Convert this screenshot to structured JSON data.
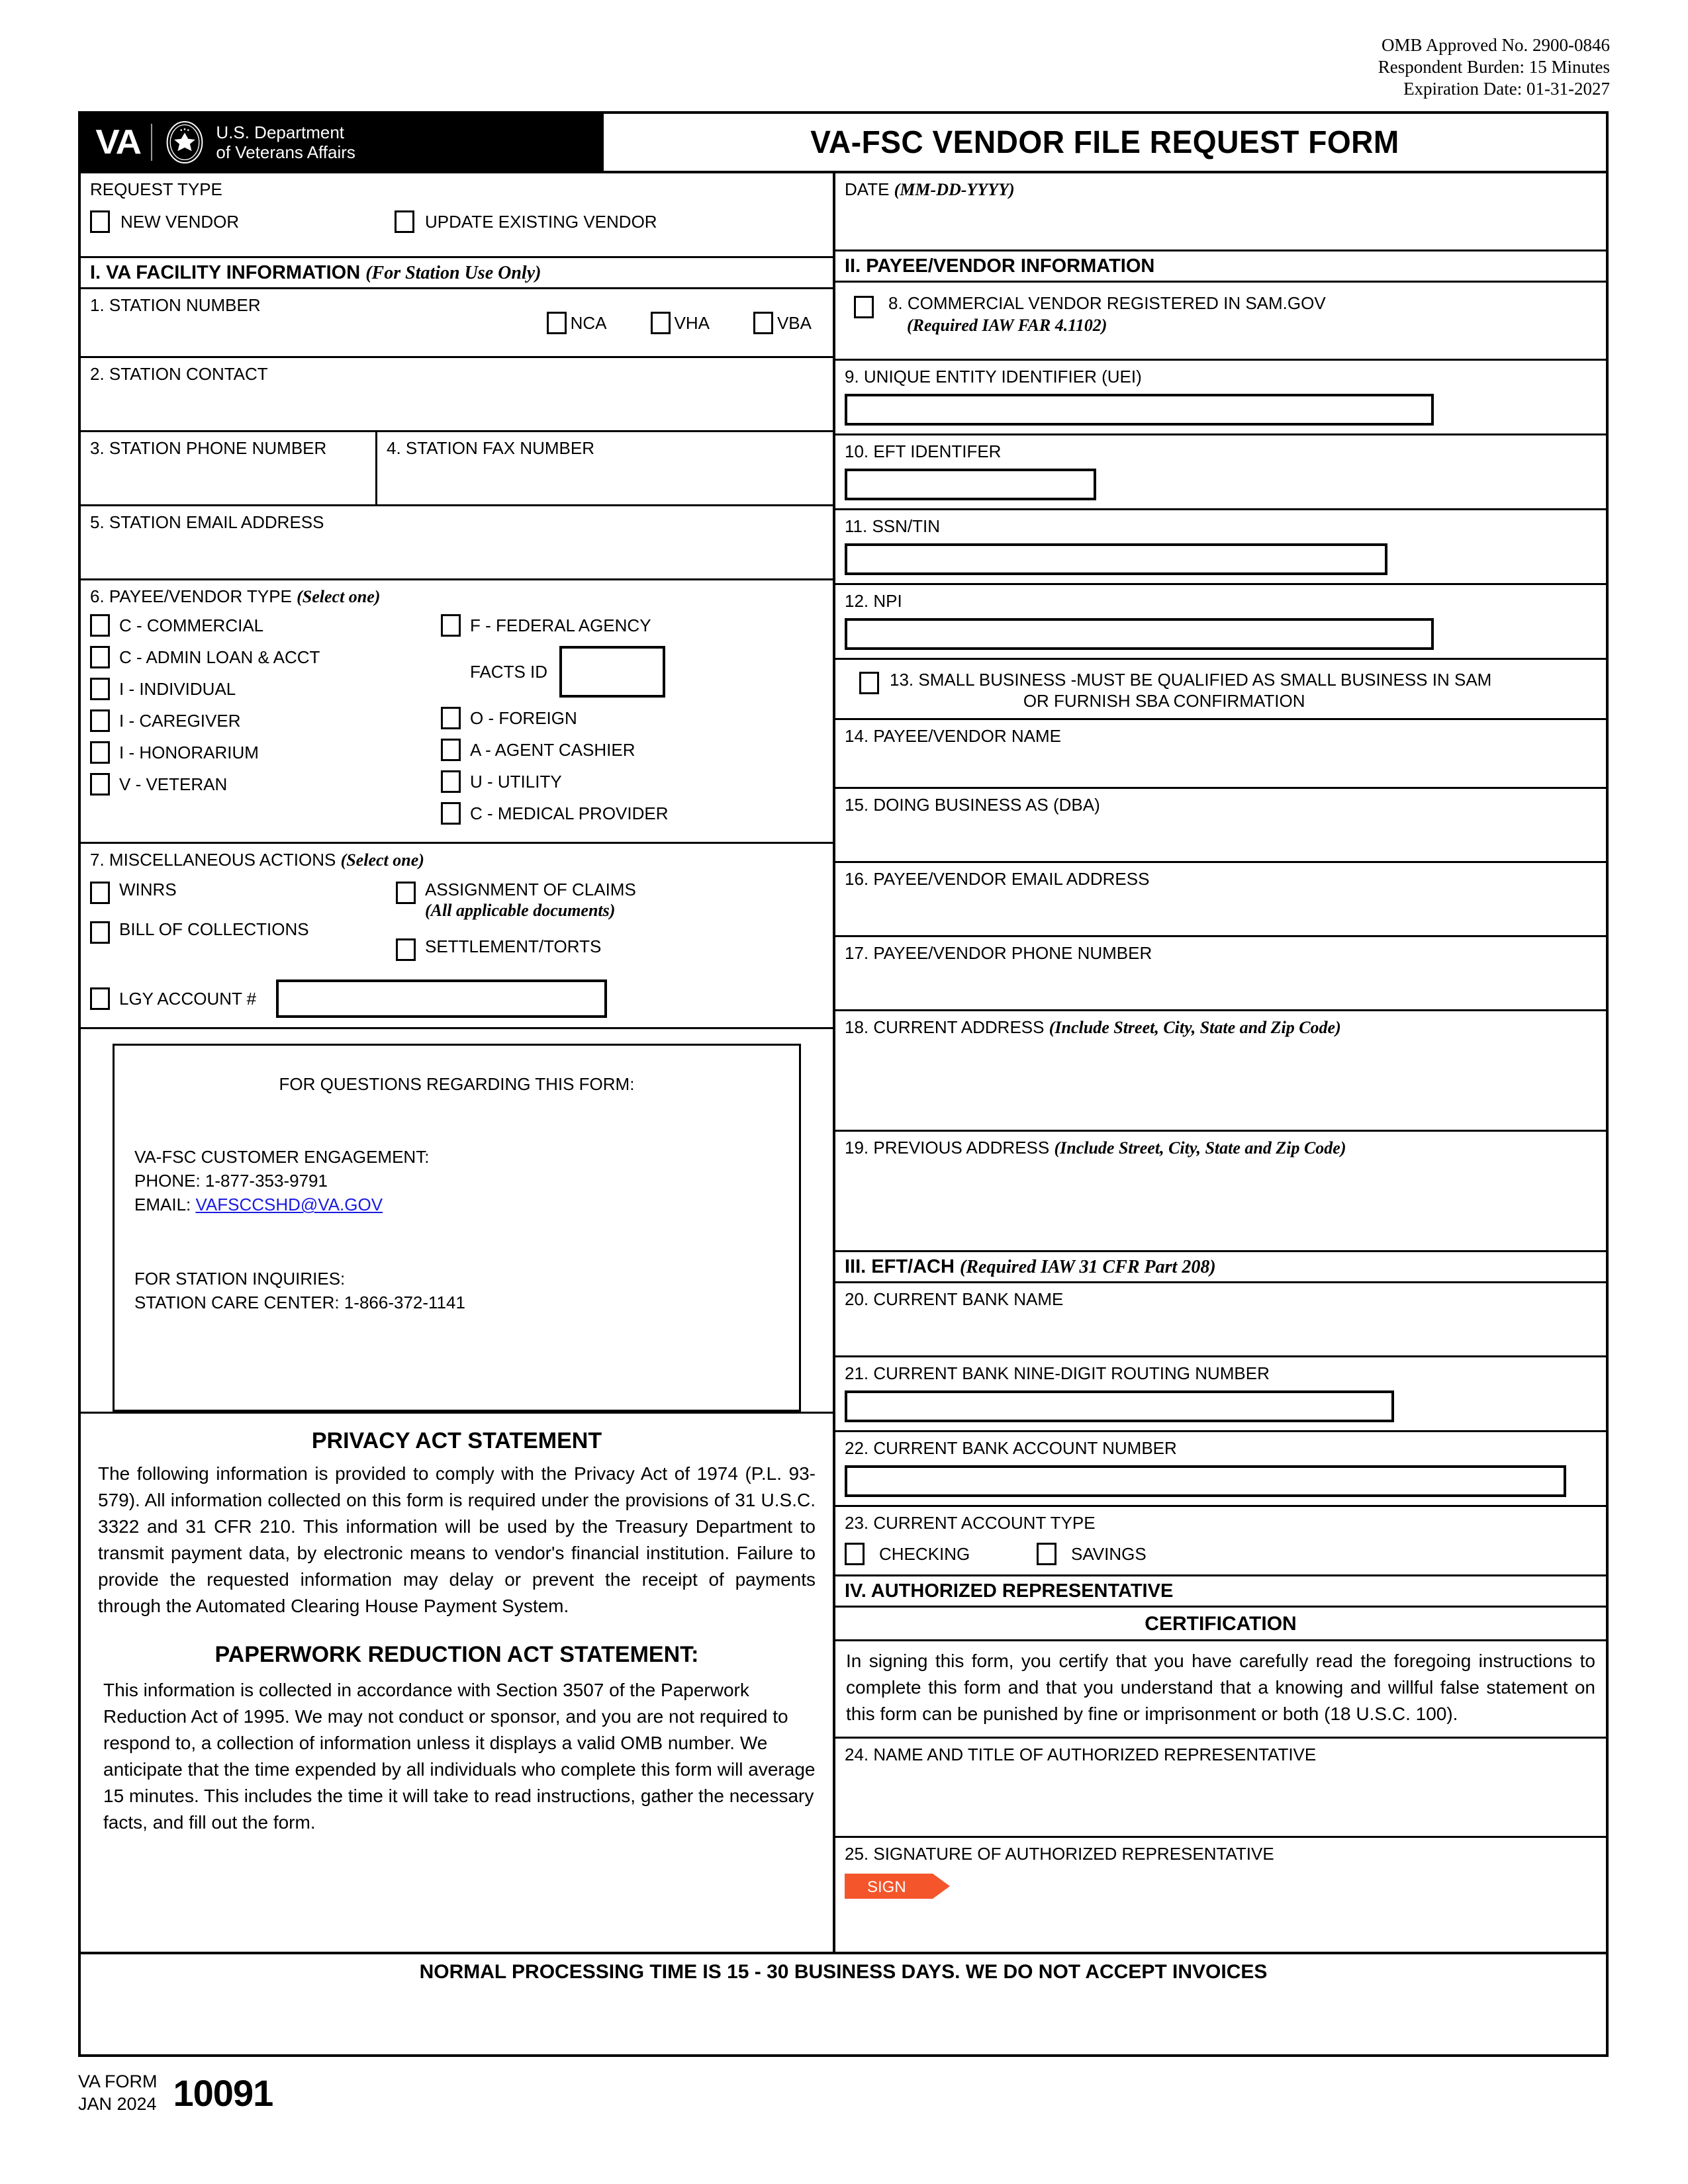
{
  "omb": {
    "approved": "OMB Approved No. 2900-0846",
    "burden": "Respondent Burden: 15 Minutes",
    "expiration": "Expiration Date: 01-31-2027"
  },
  "header": {
    "va_abbrev": "VA",
    "department_line1": "U.S. Department",
    "department_line2": "of Veterans Affairs",
    "form_title": "VA-FSC VENDOR FILE REQUEST FORM"
  },
  "request_type": {
    "label": "REQUEST TYPE",
    "options": [
      {
        "label": "NEW VENDOR"
      },
      {
        "label": "UPDATE EXISTING VENDOR"
      }
    ]
  },
  "date_field": {
    "label": "DATE",
    "format": "(MM-DD-YYYY)"
  },
  "section_1": {
    "title": "I.  VA FACILITY INFORMATION",
    "note": "(For Station Use Only)"
  },
  "section_2": {
    "title": "II.  PAYEE/VENDOR INFORMATION"
  },
  "section_3": {
    "title": "III.  EFT/ACH",
    "note": "(Required IAW 31 CFR Part 208)"
  },
  "section_4": {
    "title": "IV.  AUTHORIZED REPRESENTATIVE"
  },
  "facility": {
    "station_number": "1. STATION NUMBER",
    "agencies": [
      "NCA",
      "VHA",
      "VBA"
    ],
    "station_contact": "2. STATION CONTACT",
    "station_phone": "3. STATION PHONE NUMBER",
    "station_fax": "4. STATION FAX NUMBER",
    "station_email": "5. STATION EMAIL ADDRESS"
  },
  "vendor_type": {
    "label": "6. PAYEE/VENDOR TYPE",
    "note": "(Select one)",
    "col1": [
      "C - COMMERCIAL",
      "C - ADMIN LOAN & ACCT",
      "I - INDIVIDUAL",
      "I - CAREGIVER",
      "I - HONORARIUM",
      "V - VETERAN"
    ],
    "col2": [
      "F - FEDERAL AGENCY",
      "O - FOREIGN",
      "A - AGENT CASHIER",
      "U - UTILITY",
      "C - MEDICAL PROVIDER"
    ],
    "facts_id_label": "FACTS ID"
  },
  "misc_actions": {
    "label": "7. MISCELLANEOUS ACTIONS",
    "note": "(Select one)",
    "col1": [
      "WINRS",
      "BILL OF COLLECTIONS"
    ],
    "col2_1_line1": "ASSIGNMENT OF CLAIMS",
    "col2_1_line2": "(All applicable documents)",
    "col2_2": "SETTLEMENT/TORTS",
    "lgy_label": "LGY ACCOUNT #"
  },
  "questions_box": {
    "heading": "FOR QUESTIONS REGARDING THIS FORM:",
    "ce_title": "VA-FSC CUSTOMER ENGAGEMENT:",
    "phone_label": "PHONE:",
    "phone_value": "1-877-353-9791",
    "email_label": "EMAIL:",
    "email_value": "VAFSCCSHD@VA.GOV",
    "station_title": "FOR STATION INQUIRIES:",
    "station_line": "STATION CARE CENTER:  1-866-372-1141"
  },
  "privacy_act": {
    "title": "PRIVACY ACT STATEMENT",
    "body": "The following information is provided to comply with the Privacy Act of 1974 (P.L. 93-579). All information collected on this form is required under the provisions of 31 U.S.C. 3322 and 31 CFR 210. This information will be used by the Treasury Department to transmit payment data, by electronic means to vendor's financial institution. Failure to provide the requested information may delay or prevent the receipt of payments through the Automated Clearing House Payment System."
  },
  "paperwork_act": {
    "title": "PAPERWORK REDUCTION ACT STATEMENT:",
    "body": "This information is collected in accordance with Section 3507 of the Paperwork Reduction Act of 1995. We may not conduct or sponsor, and you are not required to respond to, a collection of information unless it displays a valid OMB number. We anticipate that the time expended by all individuals who complete this form will average 15 minutes. This includes the time it will take to read instructions, gather the necessary facts, and fill out the form."
  },
  "payee": {
    "sam_number": "8. COMMERCIAL VENDOR REGISTERED IN SAM.GOV",
    "sam_note": "(Required IAW FAR 4.1102)",
    "uei": "9. UNIQUE ENTITY IDENTIFIER (UEI)",
    "eft_identifier": "10. EFT IDENTIFER",
    "ssn_tin": "11. SSN/TIN",
    "npi": "12. NPI",
    "small_business_1": "13. SMALL BUSINESS -MUST BE QUALIFIED AS SMALL BUSINESS IN SAM",
    "small_business_2": "OR FURNISH SBA CONFIRMATION",
    "vendor_name": "14. PAYEE/VENDOR NAME",
    "dba": "15. DOING BUSINESS AS (DBA)",
    "email": "16. PAYEE/VENDOR EMAIL ADDRESS",
    "phone": "17. PAYEE/VENDOR PHONE NUMBER",
    "current_address": "18. CURRENT ADDRESS",
    "current_address_note": "(Include Street, City, State and Zip Code)",
    "previous_address": "19. PREVIOUS ADDRESS",
    "previous_address_note": "(Include Street, City, State and Zip Code)"
  },
  "eft": {
    "bank_name": "20. CURRENT BANK NAME",
    "routing": "21. CURRENT BANK NINE-DIGIT ROUTING NUMBER",
    "account_number": "22. CURRENT BANK ACCOUNT NUMBER",
    "account_type": "23. CURRENT ACCOUNT TYPE",
    "account_type_options": [
      "CHECKING",
      "SAVINGS"
    ]
  },
  "certification": {
    "heading": "CERTIFICATION",
    "body": "In signing this form, you certify that you have carefully read the foregoing instructions to complete this form and that you understand that a knowing and willful false statement on this form can be punished by fine or imprisonment or both (18 U.S.C. 100).",
    "name_title": "24. NAME AND TITLE OF AUTHORIZED REPRESENTATIVE",
    "signature": "25. SIGNATURE OF AUTHORIZED REPRESENTATIVE",
    "sign_button": "SIGN"
  },
  "footer": {
    "processing_note": "NORMAL PROCESSING TIME IS 15 - 30 BUSINESS DAYS.  WE DO NOT ACCEPT INVOICES",
    "form_label_1": "VA FORM",
    "form_label_2": "JAN 2024",
    "form_number": "10091"
  },
  "colors": {
    "sign_button": "#f4552b",
    "link": "#1a1ae0",
    "logo_background": "#000000"
  }
}
